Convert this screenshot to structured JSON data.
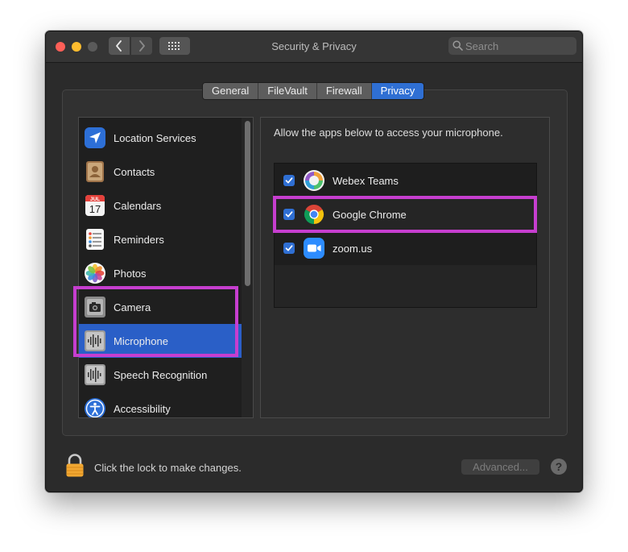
{
  "window": {
    "title": "Security & Privacy",
    "search_placeholder": "Search"
  },
  "tabs": [
    {
      "label": "General",
      "active": false
    },
    {
      "label": "FileVault",
      "active": false
    },
    {
      "label": "Firewall",
      "active": false
    },
    {
      "label": "Privacy",
      "active": true
    }
  ],
  "sidebar": {
    "items": [
      {
        "label": "Location Services",
        "icon": "location-arrow-icon"
      },
      {
        "label": "Contacts",
        "icon": "contacts-book-icon"
      },
      {
        "label": "Calendars",
        "icon": "calendar-icon"
      },
      {
        "label": "Reminders",
        "icon": "reminders-list-icon"
      },
      {
        "label": "Photos",
        "icon": "photos-flower-icon"
      },
      {
        "label": "Camera",
        "icon": "camera-icon"
      },
      {
        "label": "Microphone",
        "icon": "microphone-waveform-icon",
        "selected": true
      },
      {
        "label": "Speech Recognition",
        "icon": "speech-waveform-icon"
      },
      {
        "label": "Accessibility",
        "icon": "accessibility-icon"
      }
    ],
    "calendar_icon_month": "JUL",
    "calendar_icon_day": "17"
  },
  "main": {
    "prompt": "Allow the apps below to access your microphone.",
    "apps": [
      {
        "label": "Webex Teams",
        "checked": true,
        "icon": "webex-teams-icon"
      },
      {
        "label": "Google Chrome",
        "checked": true,
        "icon": "google-chrome-icon"
      },
      {
        "label": "zoom.us",
        "checked": true,
        "icon": "zoom-camera-icon"
      }
    ]
  },
  "footer": {
    "lock_text": "Click the lock to make changes.",
    "advanced_label": "Advanced...",
    "help_label": "?"
  },
  "colors": {
    "accent": "#2f6fd3",
    "highlight": "#c63ecf",
    "window_bg": "#2b2b2b"
  }
}
